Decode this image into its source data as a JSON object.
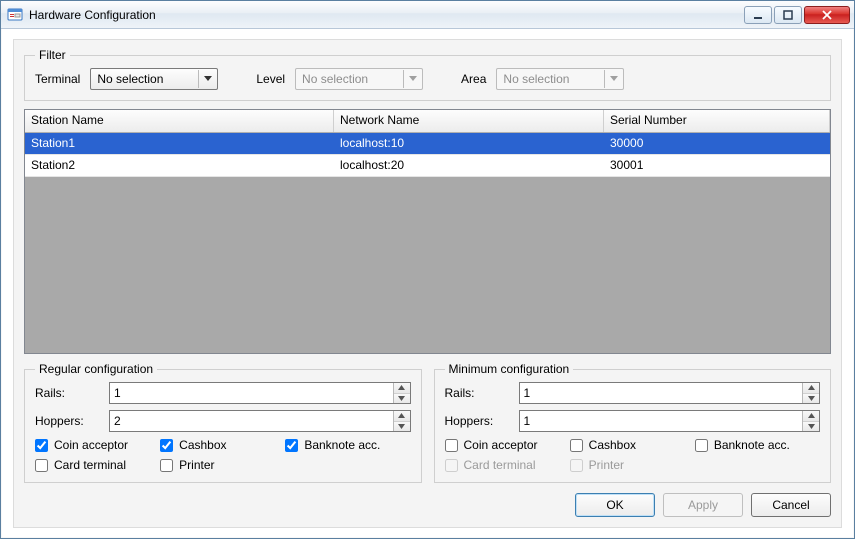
{
  "window": {
    "title": "Hardware Configuration"
  },
  "filter": {
    "legend": "Filter",
    "terminal_label": "Terminal",
    "terminal_value": "No selection",
    "level_label": "Level",
    "level_value": "No selection",
    "area_label": "Area",
    "area_value": "No selection"
  },
  "table": {
    "columns": [
      "Station Name",
      "Network Name",
      "Serial Number"
    ],
    "rows": [
      {
        "station": "Station1",
        "network": "localhost:10",
        "serial": "30000",
        "selected": true
      },
      {
        "station": "Station2",
        "network": "localhost:20",
        "serial": "30001",
        "selected": false
      }
    ]
  },
  "regular": {
    "legend": "Regular configuration",
    "rails_label": "Rails:",
    "rails_value": "1",
    "hoppers_label": "Hoppers:",
    "hoppers_value": "2",
    "coin_acceptor": {
      "label": "Coin acceptor",
      "checked": true
    },
    "cashbox": {
      "label": "Cashbox",
      "checked": true
    },
    "banknote": {
      "label": "Banknote acc.",
      "checked": true
    },
    "card_terminal": {
      "label": "Card terminal",
      "checked": false
    },
    "printer": {
      "label": "Printer",
      "checked": false
    }
  },
  "minimum": {
    "legend": "Minimum configuration",
    "rails_label": "Rails:",
    "rails_value": "1",
    "hoppers_label": "Hoppers:",
    "hoppers_value": "1",
    "coin_acceptor": {
      "label": "Coin acceptor",
      "checked": false
    },
    "cashbox": {
      "label": "Cashbox",
      "checked": false
    },
    "banknote": {
      "label": "Banknote acc.",
      "checked": false
    },
    "card_terminal": {
      "label": "Card terminal",
      "checked": false,
      "disabled": true
    },
    "printer": {
      "label": "Printer",
      "checked": false,
      "disabled": true
    }
  },
  "footer": {
    "ok": "OK",
    "apply": "Apply",
    "cancel": "Cancel"
  }
}
